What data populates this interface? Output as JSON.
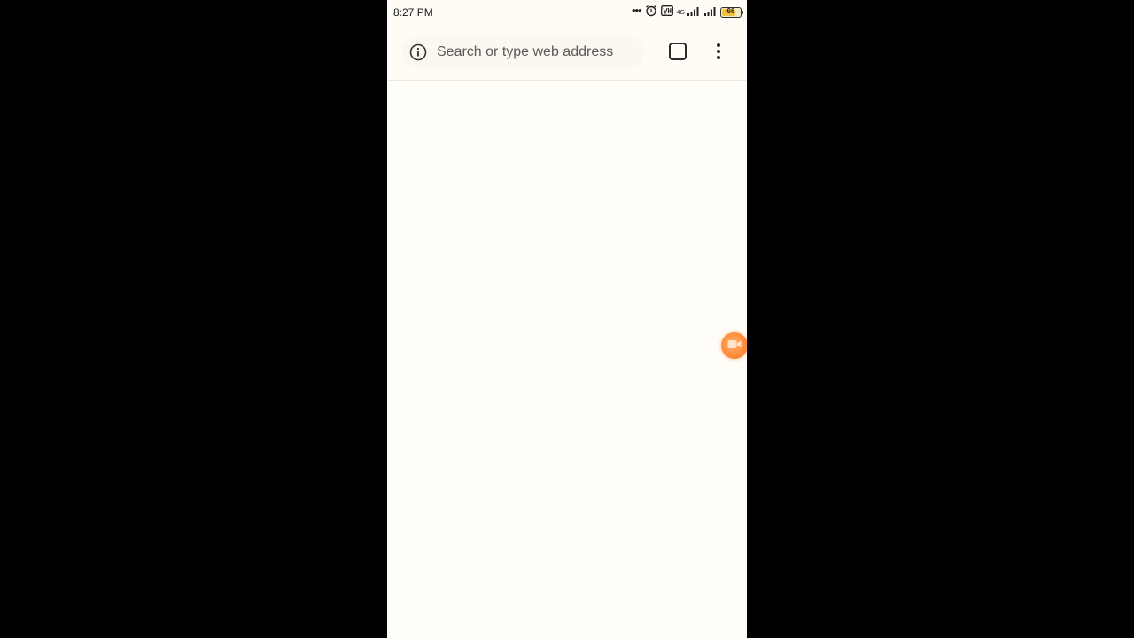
{
  "status_bar": {
    "time": "8:27 PM",
    "more_dots": "•••",
    "network_label": "4G",
    "battery_level": "66",
    "icons": [
      "alarm-icon",
      "volte-icon",
      "signal-4g-icon",
      "signal-icon",
      "battery-icon"
    ]
  },
  "toolbar": {
    "search_placeholder": "Search or type web address",
    "info_icon": "info-icon",
    "tab_switcher_icon": "tab-switcher-icon",
    "menu_icon": "more-vert-icon"
  },
  "floating": {
    "recorder_icon": "video-camera-icon",
    "recorder_color": "#ff8a3a"
  },
  "colors": {
    "page_background": "#fffdf8",
    "outer_background": "#000000"
  }
}
